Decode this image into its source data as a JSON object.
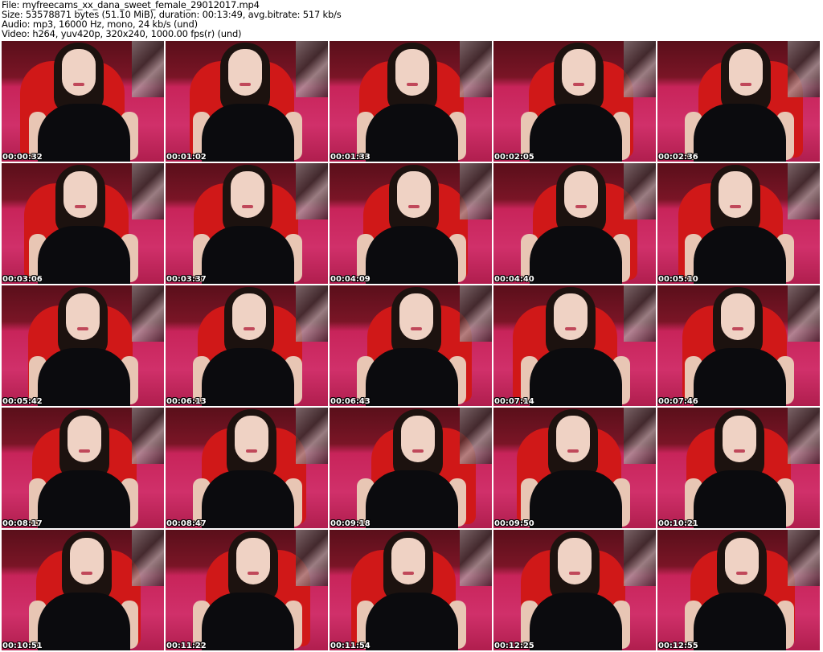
{
  "header": {
    "file": "File: myfreecams_xx_dana_sweet_female_29012017.mp4",
    "size": "Size: 53578871 bytes (51.10 MiB), duration: 00:13:49, avg.bitrate: 517 kb/s",
    "audio": "Audio: mp3, 16000 Hz, mono, 24 kb/s (und)",
    "video": "Video: h264, yuv420p, 320x240, 1000.00 fps(r) (und)"
  },
  "thumbnails": [
    "00:00:32",
    "00:01:02",
    "00:01:33",
    "00:02:05",
    "00:02:36",
    "00:03:06",
    "00:03:37",
    "00:04:09",
    "00:04:40",
    "00:05:10",
    "00:05:42",
    "00:06:13",
    "00:06:43",
    "00:07:14",
    "00:07:46",
    "00:08:17",
    "00:08:47",
    "00:09:18",
    "00:09:50",
    "00:10:21",
    "00:10:51",
    "00:11:22",
    "00:11:54",
    "00:12:25",
    "00:12:55"
  ]
}
